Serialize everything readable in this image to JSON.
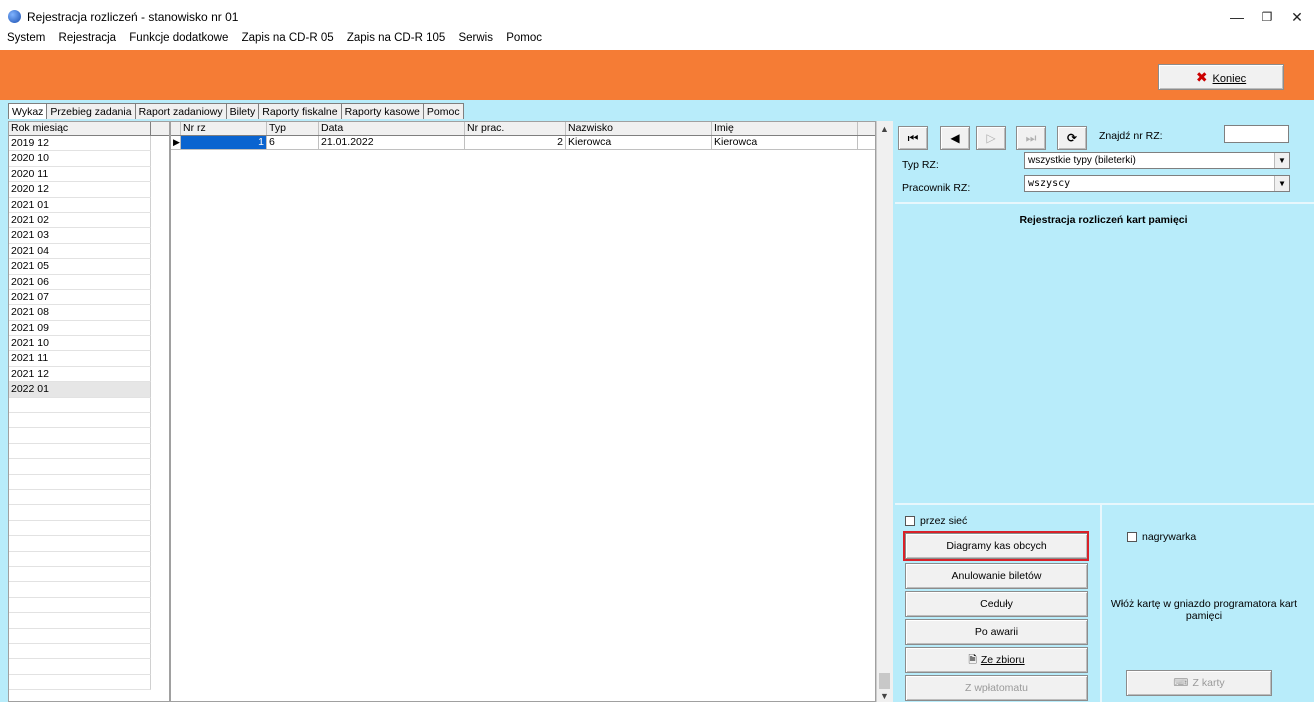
{
  "window": {
    "title": "Rejestracja rozliczeń - stanowisko nr 01",
    "minimize": "—",
    "maximize": "❐",
    "close": "✕"
  },
  "menu": [
    "System",
    "Rejestracja",
    "Funkcje dodatkowe",
    "Zapis na CD-R 05",
    "Zapis na CD-R 105",
    "Serwis",
    "Pomoc"
  ],
  "banner": {
    "close_button": "Koniec",
    "close_icon": "x-icon"
  },
  "tabs": [
    "Wykaz",
    "Przebieg zadania",
    "Raport zadaniowy",
    "Bilety",
    "Raporty fiskalne",
    "Raporty kasowe",
    "Pomoc"
  ],
  "active_tab": "Wykaz",
  "month_list": {
    "header": "Rok miesiąc",
    "items": [
      "2019 12",
      "2020 10",
      "2020 11",
      "2020 12",
      "2021 01",
      "2021 02",
      "2021 03",
      "2021 04",
      "2021 05",
      "2021 06",
      "2021 07",
      "2021 08",
      "2021 09",
      "2021 10",
      "2021 11",
      "2021 12",
      "2022 01"
    ],
    "selected": "2022 01"
  },
  "grid": {
    "columns": [
      "Nr rz",
      "Typ",
      "Data",
      "Nr prac.",
      "Nazwisko",
      "Imię"
    ],
    "rows": [
      {
        "nr_rz": "1",
        "typ": "6",
        "data": "21.01.2022",
        "nr_prac": "2",
        "nazwisko": "Kierowca",
        "imie": "Kierowca"
      }
    ]
  },
  "nav": {
    "first": "⏮",
    "prev": "◀",
    "next": "▷",
    "last": "⏭",
    "refresh": "⟳"
  },
  "find": {
    "label": "Znajdź nr RZ:",
    "value": ""
  },
  "filters": {
    "typ_label": "Typ RZ:",
    "typ_value": "wszystkie typy (bileterki)",
    "pracownik_label": "Pracownik RZ:",
    "pracownik_value": "wszyscy"
  },
  "section_title": "Rejestracja rozliczeń kart pamięci",
  "przez_siec": "przez sieć",
  "nagrywarka": "nagrywarka",
  "buttons": {
    "diagramy": "Diagramy kas obcych",
    "anulowanie": "Anulowanie biletów",
    "cedula": "Ceduły",
    "po_awarii": "Po awarii",
    "ze_zbioru": "Ze zbioru",
    "z_wplatomatu": "Z wpłatomatu",
    "z_karty": "Z karty"
  },
  "insert_card_text": "Włóż kartę w gniazdo programatora kart pamięci",
  "colors": {
    "banner": "#f57c35",
    "panel": "#b8ecfa",
    "highlight": "#d9222a"
  }
}
